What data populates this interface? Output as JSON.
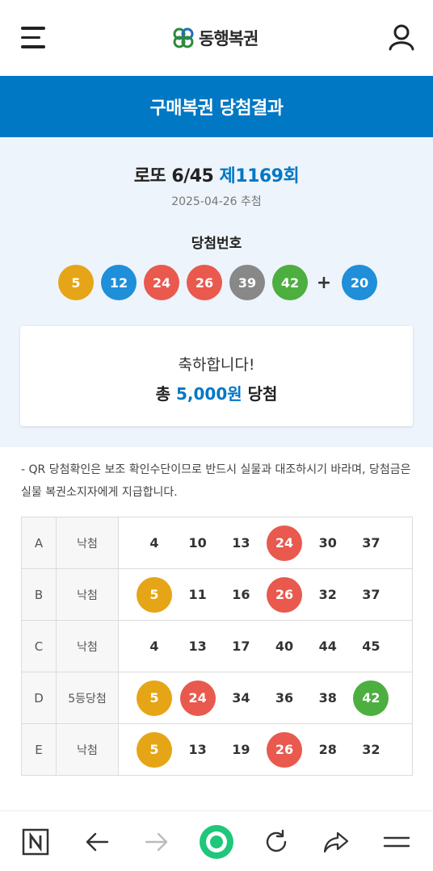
{
  "header": {
    "logo_text": "동행복권",
    "menu_icon": "hamburger-menu-icon",
    "user_icon": "user-icon"
  },
  "title_bar": {
    "title": "구매복권 당첨결과"
  },
  "result": {
    "game_name": "로또 6/45 ",
    "round": "제1169회",
    "draw_date": "2025-04-26 추첨",
    "winning_label": "당첨번호",
    "winning_numbers": [
      {
        "value": "5",
        "color": "#e5a516"
      },
      {
        "value": "12",
        "color": "#1e8fd8"
      },
      {
        "value": "24",
        "color": "#e9594e"
      },
      {
        "value": "26",
        "color": "#e9594e"
      },
      {
        "value": "39",
        "color": "#888888"
      },
      {
        "value": "42",
        "color": "#4caf3f"
      }
    ],
    "plus": "+",
    "bonus_number": {
      "value": "20",
      "color": "#1e8fd8"
    }
  },
  "congrats": {
    "line1": "축하합니다!",
    "prefix": "총 ",
    "amount": "5,000원",
    "suffix": " 당첨"
  },
  "notice": "- QR 당첨확인은 보조 확인수단이므로 반드시 실물과 대조하시기 바라며, 당첨금은 실물 복권소지자에게 지급합니다.",
  "tickets": [
    {
      "game": "A",
      "status": "낙첨",
      "numbers": [
        {
          "v": "4"
        },
        {
          "v": "10"
        },
        {
          "v": "13"
        },
        {
          "v": "24",
          "color": "#e9594e"
        },
        {
          "v": "30"
        },
        {
          "v": "37"
        }
      ]
    },
    {
      "game": "B",
      "status": "낙첨",
      "numbers": [
        {
          "v": "5",
          "color": "#e5a516"
        },
        {
          "v": "11"
        },
        {
          "v": "16"
        },
        {
          "v": "26",
          "color": "#e9594e"
        },
        {
          "v": "32"
        },
        {
          "v": "37"
        }
      ]
    },
    {
      "game": "C",
      "status": "낙첨",
      "numbers": [
        {
          "v": "4"
        },
        {
          "v": "13"
        },
        {
          "v": "17"
        },
        {
          "v": "40"
        },
        {
          "v": "44"
        },
        {
          "v": "45"
        }
      ]
    },
    {
      "game": "D",
      "status": "5등당첨",
      "numbers": [
        {
          "v": "5",
          "color": "#e5a516"
        },
        {
          "v": "24",
          "color": "#e9594e"
        },
        {
          "v": "34"
        },
        {
          "v": "36"
        },
        {
          "v": "38"
        },
        {
          "v": "42",
          "color": "#4caf3f"
        }
      ]
    },
    {
      "game": "E",
      "status": "낙첨",
      "numbers": [
        {
          "v": "5",
          "color": "#e5a516"
        },
        {
          "v": "13"
        },
        {
          "v": "19"
        },
        {
          "v": "26",
          "color": "#e9594e"
        },
        {
          "v": "28"
        },
        {
          "v": "32"
        }
      ]
    }
  ],
  "bottom_nav": [
    "n-logo-icon",
    "back-arrow-icon",
    "forward-arrow-icon",
    "home-circle-icon",
    "refresh-icon",
    "share-icon",
    "menu-lines-icon"
  ],
  "colors": {
    "brand_blue": "#0078c4",
    "light_bg": "#eef4fb",
    "home_green": "#1fc77a"
  }
}
